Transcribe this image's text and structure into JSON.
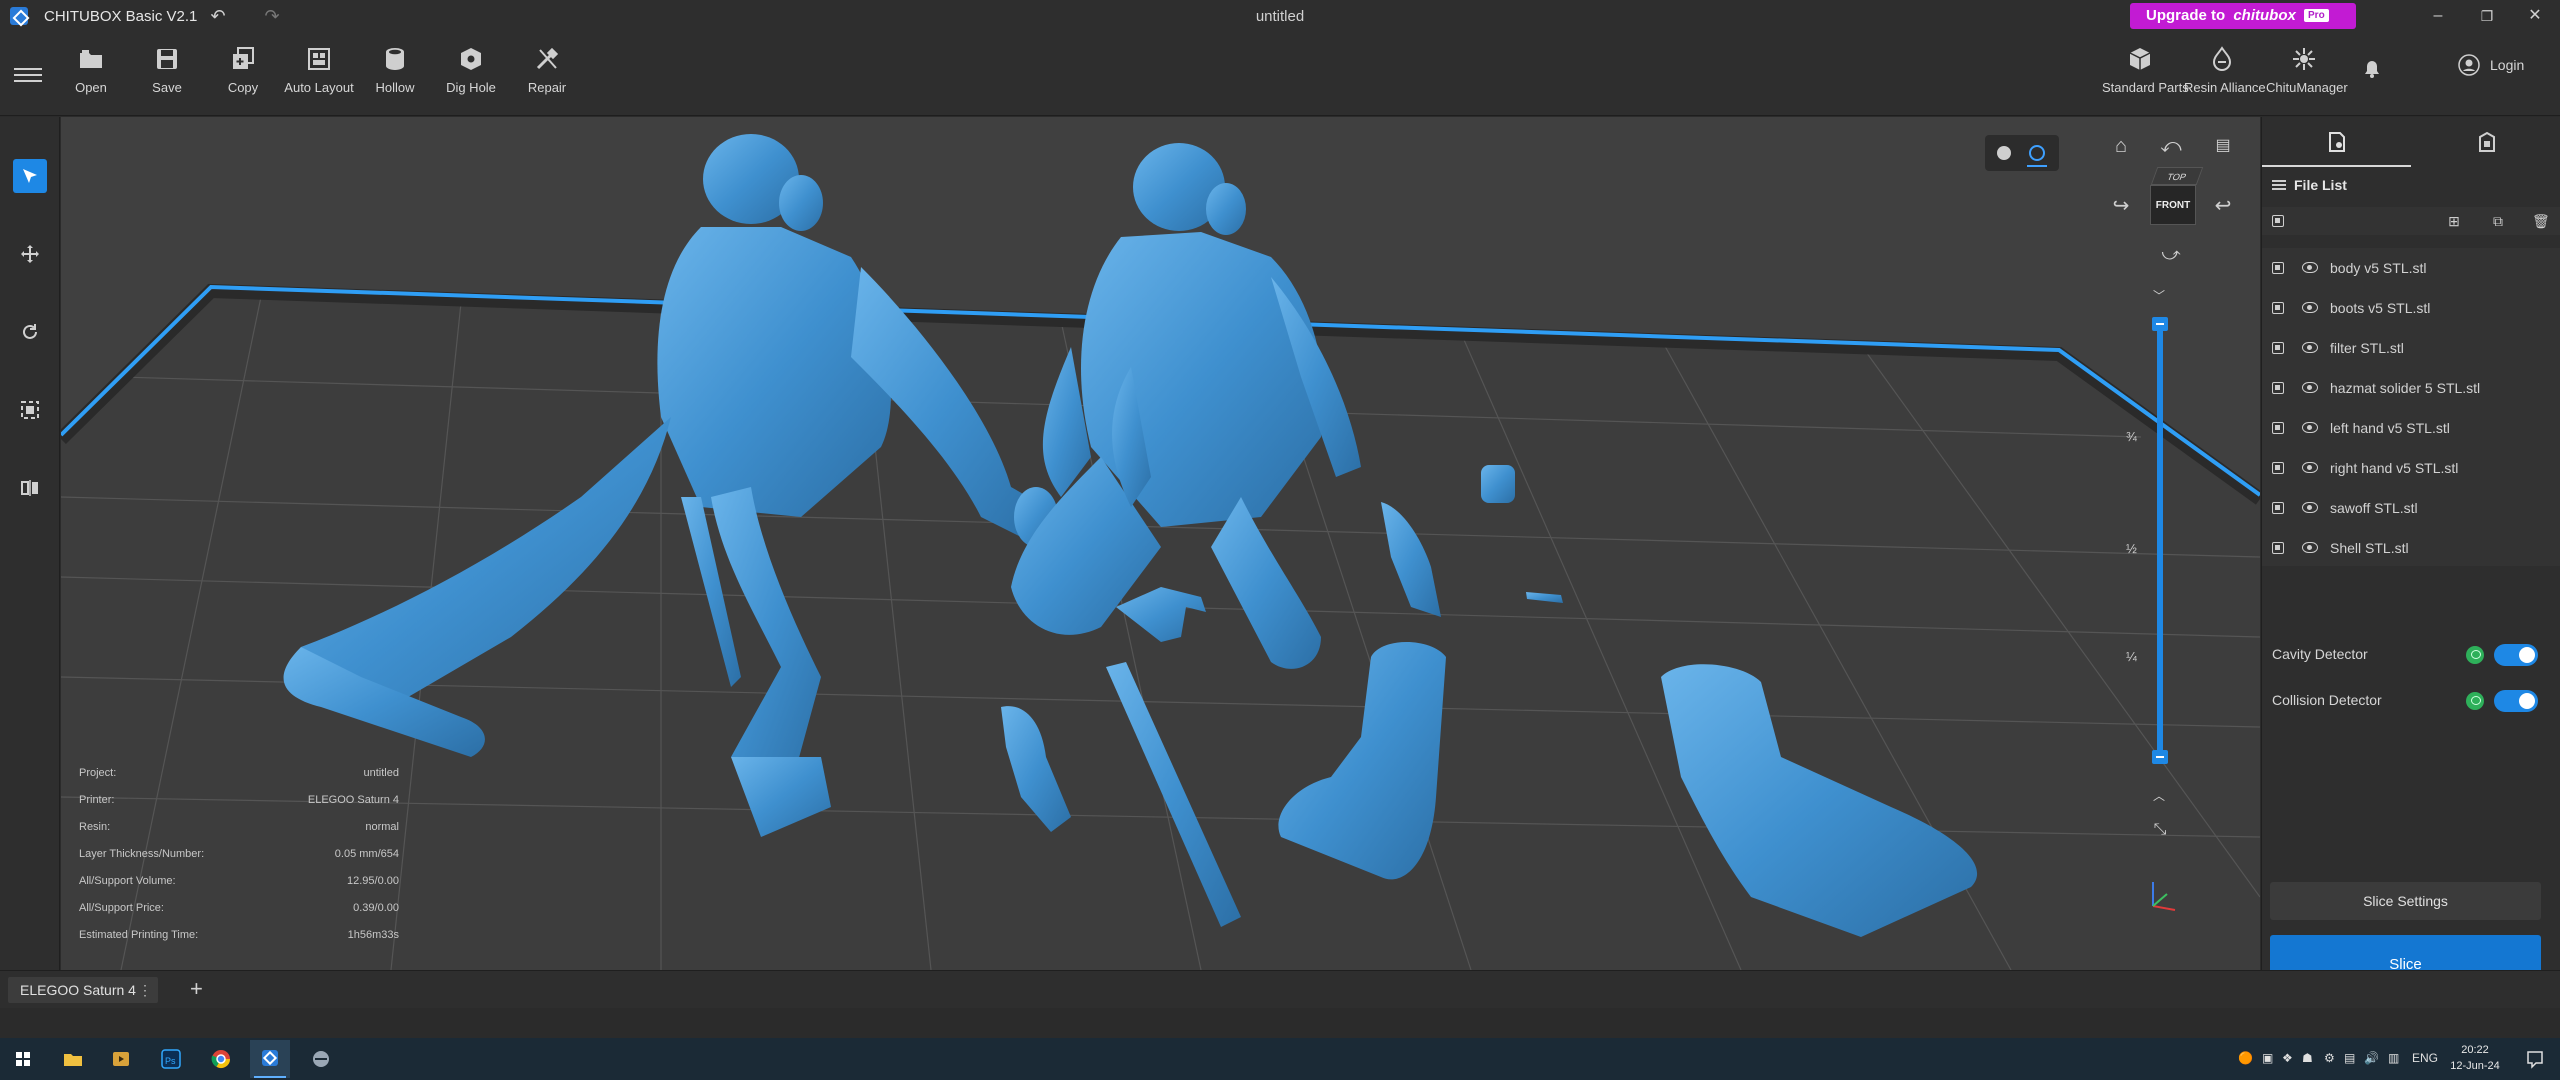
{
  "window": {
    "app_title": "CHITUBOX Basic V2.1",
    "document_title": "untitled",
    "upgrade_label": "Upgrade to",
    "upgrade_brand": "chitubox",
    "upgrade_badge": "Pro",
    "minimize": "–",
    "maximize": "❐",
    "close": "✕"
  },
  "toolbar": {
    "tools": [
      {
        "label": "Open",
        "icon": "folder-icon"
      },
      {
        "label": "Save",
        "icon": "save-icon"
      },
      {
        "label": "Copy",
        "icon": "copy-icon"
      },
      {
        "label": "Auto Layout",
        "icon": "auto-layout-icon"
      },
      {
        "label": "Hollow",
        "icon": "hollow-icon"
      },
      {
        "label": "Dig Hole",
        "icon": "dig-hole-icon"
      },
      {
        "label": "Repair",
        "icon": "repair-icon"
      }
    ],
    "right_tools": [
      {
        "label": "Standard Parts",
        "icon": "standard-parts-icon"
      },
      {
        "label": "Resin Alliance",
        "icon": "resin-alliance-icon"
      },
      {
        "label": "ChituManager",
        "icon": "chitumanager-icon"
      }
    ],
    "login_label": "Login"
  },
  "viewport": {
    "viewcube_top": "TOP",
    "viewcube_front": "FRONT",
    "slider_marks": [
      "¾",
      "½",
      "¼"
    ],
    "slider_level": 1.0
  },
  "info": [
    {
      "key": "Project:",
      "value": "untitled"
    },
    {
      "key": "Printer:",
      "value": "ELEGOO Saturn 4"
    },
    {
      "key": "Resin:",
      "value": "normal"
    },
    {
      "key": "Layer Thickness/Number:",
      "value": "0.05 mm/654"
    },
    {
      "key": "All/Support Volume:",
      "value": "12.95/0.00"
    },
    {
      "key": "All/Support Price:",
      "value": "0.39/0.00"
    },
    {
      "key": "Estimated Printing Time:",
      "value": "1h56m33s"
    }
  ],
  "panel": {
    "file_list_title": "File List",
    "files": [
      "body v5 STL.stl",
      "boots v5 STL.stl",
      "filter STL.stl",
      "hazmat solider 5 STL.stl",
      "left hand v5 STL.stl",
      "right hand v5 STL.stl",
      "sawoff STL.stl",
      "Shell STL.stl"
    ],
    "detectors": [
      {
        "label": "Cavity Detector",
        "enabled": true
      },
      {
        "label": "Collision Detector",
        "enabled": true
      }
    ],
    "slice_settings_label": "Slice Settings",
    "slice_label": "Slice"
  },
  "bottom": {
    "printer_tab": "ELEGOO Saturn 4",
    "tab_menu": "⋮",
    "add_tab": "+"
  },
  "taskbar": {
    "lang": "ENG",
    "time": "20:22",
    "date": "12-Jun-24"
  },
  "colors": {
    "accent": "#1e88e5",
    "model": "#4a9ad6",
    "upgrade": "#c21bd3",
    "viewport_bg": "#404040"
  }
}
